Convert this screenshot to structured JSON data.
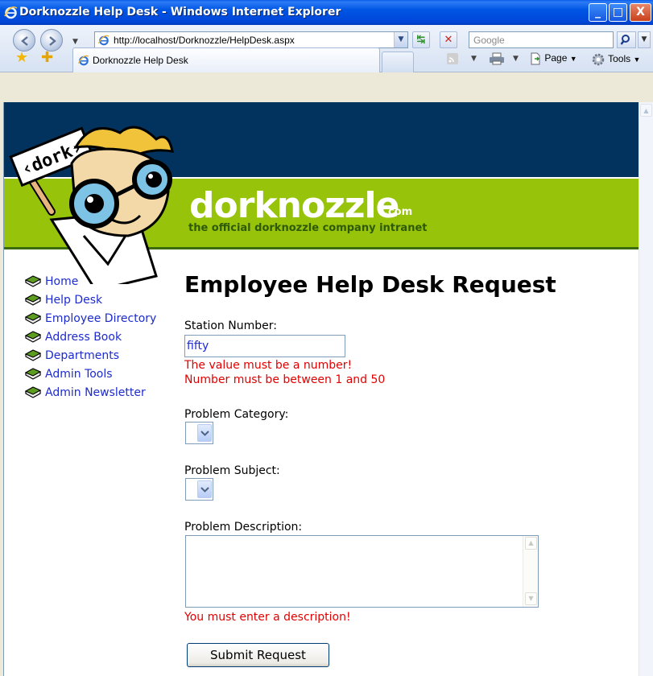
{
  "window": {
    "title": "Dorknozzle Help Desk - Windows Internet Explorer",
    "minimize_glyph": "_",
    "maximize_glyph": "□",
    "close_glyph": "X"
  },
  "address_bar": {
    "url": "http://localhost/Dorknozzle/HelpDesk.aspx",
    "search_placeholder": "Google"
  },
  "tab": {
    "label": "Dorknozzle Help Desk"
  },
  "command_bar": {
    "page_label": "Page",
    "tools_label": "Tools"
  },
  "header": {
    "logo_badge_text": "‹dork›",
    "brand": "dorknozzle",
    "brand_suffix": ".com",
    "tagline": "the official dorknozzle company intranet"
  },
  "nav": {
    "items": [
      {
        "label": "Home"
      },
      {
        "label": "Help Desk"
      },
      {
        "label": "Employee Directory"
      },
      {
        "label": "Address Book"
      },
      {
        "label": "Departments"
      },
      {
        "label": "Admin Tools"
      },
      {
        "label": "Admin Newsletter"
      }
    ]
  },
  "form": {
    "heading": "Employee Help Desk Request",
    "station_label": "Station Number:",
    "station_value": "fifty",
    "station_error_1": "The value must be a number!",
    "station_error_2": "Number must be between 1 and 50",
    "category_label": "Problem Category:",
    "subject_label": "Problem Subject:",
    "description_label": "Problem Description:",
    "description_value": "",
    "description_error": "You must enter a description!",
    "submit_label": "Submit Request"
  },
  "colors": {
    "banner_dark_blue": "#02335E",
    "banner_green": "#97C30A",
    "link_blue": "#1D2BCF",
    "error_red": "#E30000"
  }
}
